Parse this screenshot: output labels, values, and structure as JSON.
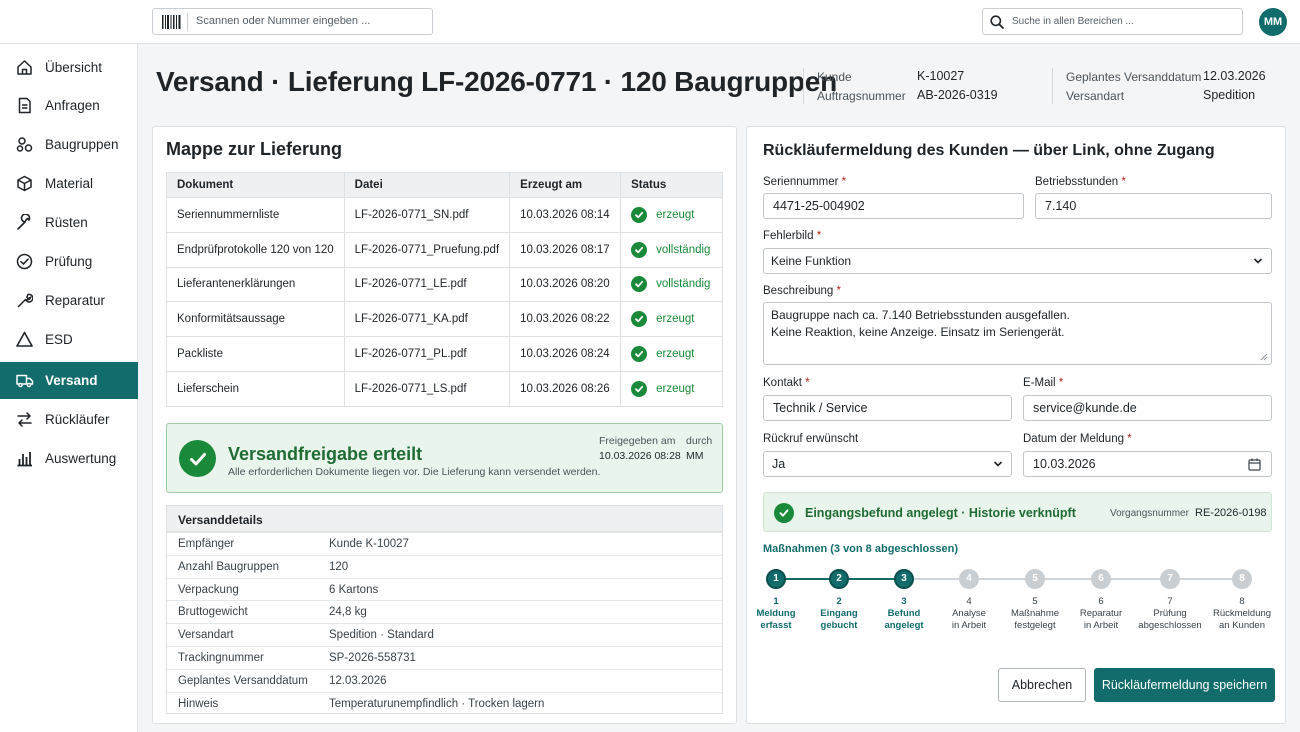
{
  "topbar": {
    "scan_placeholder": "Scannen oder Nummer eingeben ...",
    "search_placeholder": "Suche in allen Bereichen ...",
    "avatar": "MM"
  },
  "sidebar": {
    "items": [
      {
        "label": "Übersicht",
        "icon": "home-icon"
      },
      {
        "label": "Anfragen",
        "icon": "document-icon"
      },
      {
        "label": "Baugruppen",
        "icon": "assembly-icon"
      },
      {
        "label": "Material",
        "icon": "box-icon"
      },
      {
        "label": "Rüsten",
        "icon": "wrench-icon"
      },
      {
        "label": "Prüfung",
        "icon": "check-circle-icon"
      },
      {
        "label": "Reparatur",
        "icon": "repair-icon"
      },
      {
        "label": "ESD",
        "icon": "warning-icon"
      },
      {
        "label": "Versand",
        "icon": "truck-icon",
        "active": true
      },
      {
        "label": "Rückläufer",
        "icon": "swap-icon"
      },
      {
        "label": "Auswertung",
        "icon": "bar-chart-icon"
      }
    ]
  },
  "header": {
    "title": "Versand · Lieferung LF-2026-0771 · 120 Baugruppen",
    "kunde_label": "Kunde",
    "kunde": "K-10027",
    "auftrag_label": "Auftragsnummer",
    "auftrag": "AB-2026-0319",
    "datum_label": "Geplantes Versanddatum",
    "datum": "12.03.2026",
    "versandart_label": "Versandart",
    "versandart": "Spedition"
  },
  "mappe": {
    "title": "Mappe zur Lieferung",
    "columns": [
      "Dokument",
      "Datei",
      "Erzeugt am",
      "Status"
    ],
    "rows": [
      {
        "doc": "Seriennummernliste",
        "file": "LF-2026-0771_SN.pdf",
        "date": "10.03.2026 08:14",
        "status": "erzeugt"
      },
      {
        "doc": "Endprüfprotokolle 120 von 120",
        "file": "LF-2026-0771_Pruefung.pdf",
        "date": "10.03.2026 08:17",
        "status": "vollständig"
      },
      {
        "doc": "Lieferantenerklärungen",
        "file": "LF-2026-0771_LE.pdf",
        "date": "10.03.2026 08:20",
        "status": "vollständig"
      },
      {
        "doc": "Konformitätsaussage",
        "file": "LF-2026-0771_KA.pdf",
        "date": "10.03.2026 08:22",
        "status": "erzeugt"
      },
      {
        "doc": "Packliste",
        "file": "LF-2026-0771_PL.pdf",
        "date": "10.03.2026 08:24",
        "status": "erzeugt"
      },
      {
        "doc": "Lieferschein",
        "file": "LF-2026-0771_LS.pdf",
        "date": "10.03.2026 08:26",
        "status": "erzeugt"
      }
    ]
  },
  "release": {
    "title": "Versandfreigabe erteilt",
    "subtitle": "Alle erforderlichen Dokumente liegen vor. Die Lieferung kann versendet werden.",
    "date_label": "Freigegeben am",
    "date": "10.03.2026 08:28",
    "by_label": "durch",
    "by": "MM"
  },
  "details": {
    "title": "Versanddetails",
    "rows": [
      {
        "k": "Empfänger",
        "v": "Kunde K-10027"
      },
      {
        "k": "Anzahl Baugruppen",
        "v": "120"
      },
      {
        "k": "Verpackung",
        "v": "6 Kartons"
      },
      {
        "k": "Bruttogewicht",
        "v": "24,8 kg"
      },
      {
        "k": "Versandart",
        "v": "Spedition · Standard"
      },
      {
        "k": "Trackingnummer",
        "v": "SP-2026-558731"
      },
      {
        "k": "Geplantes Versanddatum",
        "v": "12.03.2026"
      },
      {
        "k": "Hinweis",
        "v": "Temperaturunempfindlich · Trocken lagern"
      }
    ]
  },
  "form": {
    "title": "Rückläufermeldung des Kunden — über Link, ohne Zugang",
    "serial_label": "Seriennummer",
    "serial": "4471-25-004902",
    "hours_label": "Betriebsstunden",
    "hours": "7.140",
    "fault_label": "Fehlerbild",
    "fault": "Keine Funktion",
    "desc_label": "Beschreibung",
    "desc_line1": "Baugruppe nach ca. 7.140 Betriebsstunden ausgefallen.",
    "desc_line2": "Keine Reaktion, keine Anzeige. Einsatz im Seriengerät.",
    "contact_label": "Kontakt",
    "contact": "Technik / Service",
    "email_label": "E-Mail",
    "email": "service@kunde.de",
    "callback_label": "Rückruf erwünscht",
    "callback": "Ja",
    "msgdate_label": "Datum der Meldung",
    "msgdate": "10.03.2026",
    "required_mark": "*",
    "info_title": "Eingangsbefund angelegt · Historie verknüpft",
    "info_label": "Vorgangsnummer",
    "info_value": "RE-2026-0198",
    "steps_title": "Maßnahmen (3 von 8 abgeschlossen)",
    "steps": [
      {
        "n": "1",
        "l1": "Meldung",
        "l2": "erfasst",
        "done": true
      },
      {
        "n": "2",
        "l1": "Eingang",
        "l2": "gebucht",
        "done": true
      },
      {
        "n": "3",
        "l1": "Befund",
        "l2": "angelegt",
        "done": true
      },
      {
        "n": "4",
        "l1": "Analyse",
        "l2": "in Arbeit",
        "done": false
      },
      {
        "n": "5",
        "l1": "Maßnahme",
        "l2": "festgelegt",
        "done": false
      },
      {
        "n": "6",
        "l1": "Reparatur",
        "l2": "in Arbeit",
        "done": false
      },
      {
        "n": "7",
        "l1": "Prüfung",
        "l2": "abgeschlossen",
        "done": false
      },
      {
        "n": "8",
        "l1": "Rückmeldung",
        "l2": "an Kunden",
        "done": false
      }
    ],
    "cancel": "Abbrechen",
    "save": "Rückläufermeldung speichern"
  },
  "colors": {
    "accent": "#136c6c",
    "success": "#1a8a3a"
  }
}
